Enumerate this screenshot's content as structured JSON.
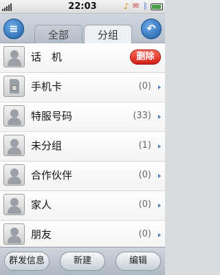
{
  "status_bar": {
    "time": "22:03",
    "icons": [
      "signal-icon",
      "music-note-icon",
      "mail-icon",
      "bluetooth-icon",
      "battery-icon"
    ]
  },
  "header": {
    "menu_icon": "list-menu-icon",
    "back_icon": "back-arrow-icon",
    "tabs": [
      {
        "label": "全部",
        "selected": false
      },
      {
        "label": "分组",
        "selected": true
      }
    ]
  },
  "groups": [
    {
      "name": "话　机",
      "count": "",
      "icon": "contact-icon",
      "action": "删除"
    },
    {
      "name": "手机卡",
      "count": "(0)",
      "icon": "sim-card-icon"
    },
    {
      "name": "特服号码",
      "count": "(33)",
      "icon": "contact-icon"
    },
    {
      "name": "未分组",
      "count": "(1)",
      "icon": "contact-icon"
    },
    {
      "name": "合作伙伴",
      "count": "(0)",
      "icon": "contact-icon"
    },
    {
      "name": "家人",
      "count": "(0)",
      "icon": "contact-icon"
    },
    {
      "name": "朋友",
      "count": "(0)",
      "icon": "contact-icon"
    }
  ],
  "toolbar": {
    "broadcast_label": "群发信息",
    "new_label": "新建",
    "edit_label": "编辑"
  },
  "colors": {
    "accent_blue": "#1f5fa6",
    "delete_red": "#d01e12"
  }
}
